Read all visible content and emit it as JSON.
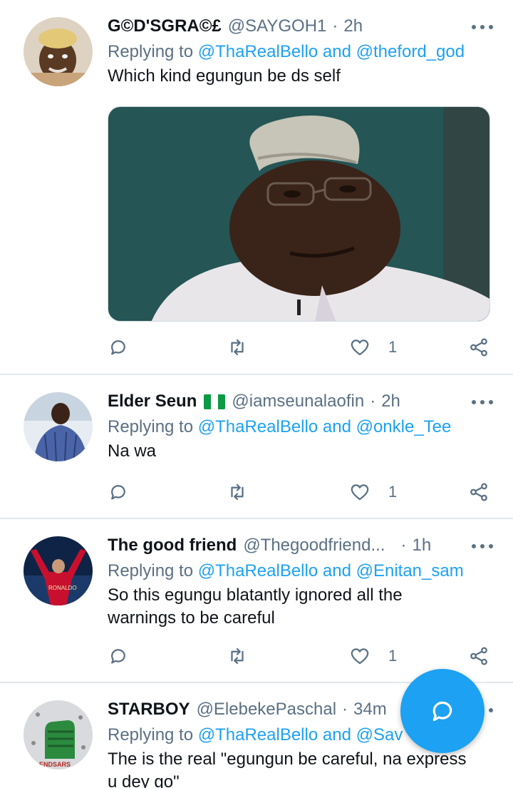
{
  "colors": {
    "accent": "#1da1f2",
    "muted": "#5b7083",
    "text": "#0f1419"
  },
  "tweets": [
    {
      "name": "G©D'SGRA©£",
      "handle": "@SAYGOH1",
      "separator": "·",
      "time": "2h",
      "replying_prefix": "Replying to",
      "mention1": "@ThaRealBello",
      "conj": "and",
      "mention2": "@theford_god",
      "text": "Which kind egungun be ds self",
      "has_media": true,
      "like_count": "1"
    },
    {
      "name": "Elder Seun",
      "flag": "nigeria-flag",
      "handle": "@iamseunalaofin",
      "separator": "·",
      "time": "2h",
      "replying_prefix": "Replying to",
      "mention1": "@ThaRealBello",
      "conj": "and",
      "mention2": "@onkle_Tee",
      "text": "Na wa",
      "like_count": "1"
    },
    {
      "name": "The good friend",
      "handle": "@Thegoodfriend...",
      "separator": "·",
      "time": "1h",
      "replying_prefix": "Replying to",
      "mention1": "@ThaRealBello",
      "conj": "and",
      "mention2": "@Enitan_sam",
      "text_line1": "So this egungu blatantly ignored all the",
      "text_line2": "warnings to be careful",
      "like_count": "1"
    },
    {
      "name": "STARBOY",
      "handle": "@ElebekePaschal",
      "separator": "·",
      "time": "34m",
      "replying_prefix": "Replying to",
      "mention1": "@ThaRealBello",
      "conj": "and",
      "mention2": "@Sav",
      "text_line1": "The is the real \"egungun be careful, na express",
      "text_line2": "u dey go\"",
      "avatar_text": "ENDSARS"
    }
  ],
  "icons": {
    "reply": "reply-icon",
    "retweet": "retweet-icon",
    "like": "heart-icon",
    "share": "share-icon",
    "compose": "compose-reply-icon",
    "more": "more-options-icon"
  }
}
